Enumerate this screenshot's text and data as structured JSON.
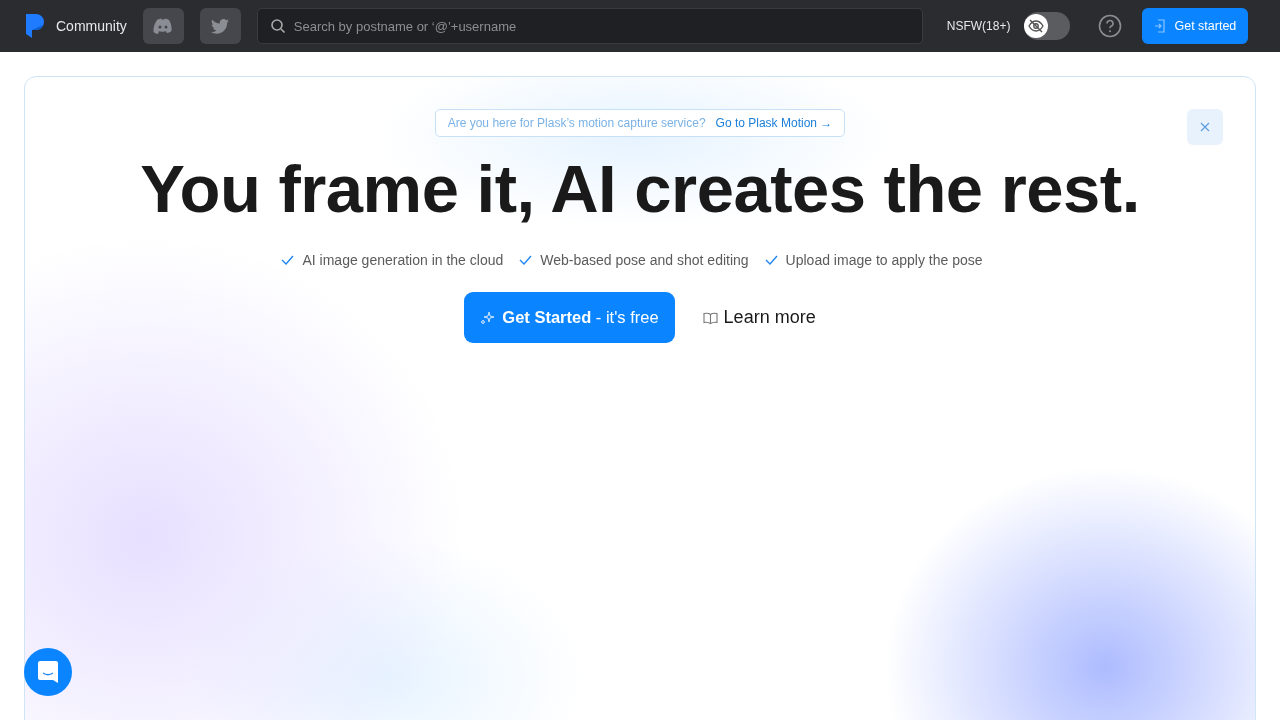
{
  "header": {
    "brand": "Community",
    "search": {
      "placeholder": "Search by postname or ‘@’+username"
    },
    "nsfw": {
      "label": "NSFW(18+)",
      "on": false
    },
    "cta": "Get started"
  },
  "hero": {
    "notice": {
      "text": "Are you here for Plask’s motion capture service?",
      "link": "Go to Plask Motion →"
    },
    "title": "You frame it, AI creates the rest.",
    "features": [
      "AI image generation in the cloud",
      "Web-based pose and shot editing",
      "Upload image to apply the pose"
    ],
    "primary": "**Get Started** - it's free",
    "secondary": "Learn more"
  }
}
